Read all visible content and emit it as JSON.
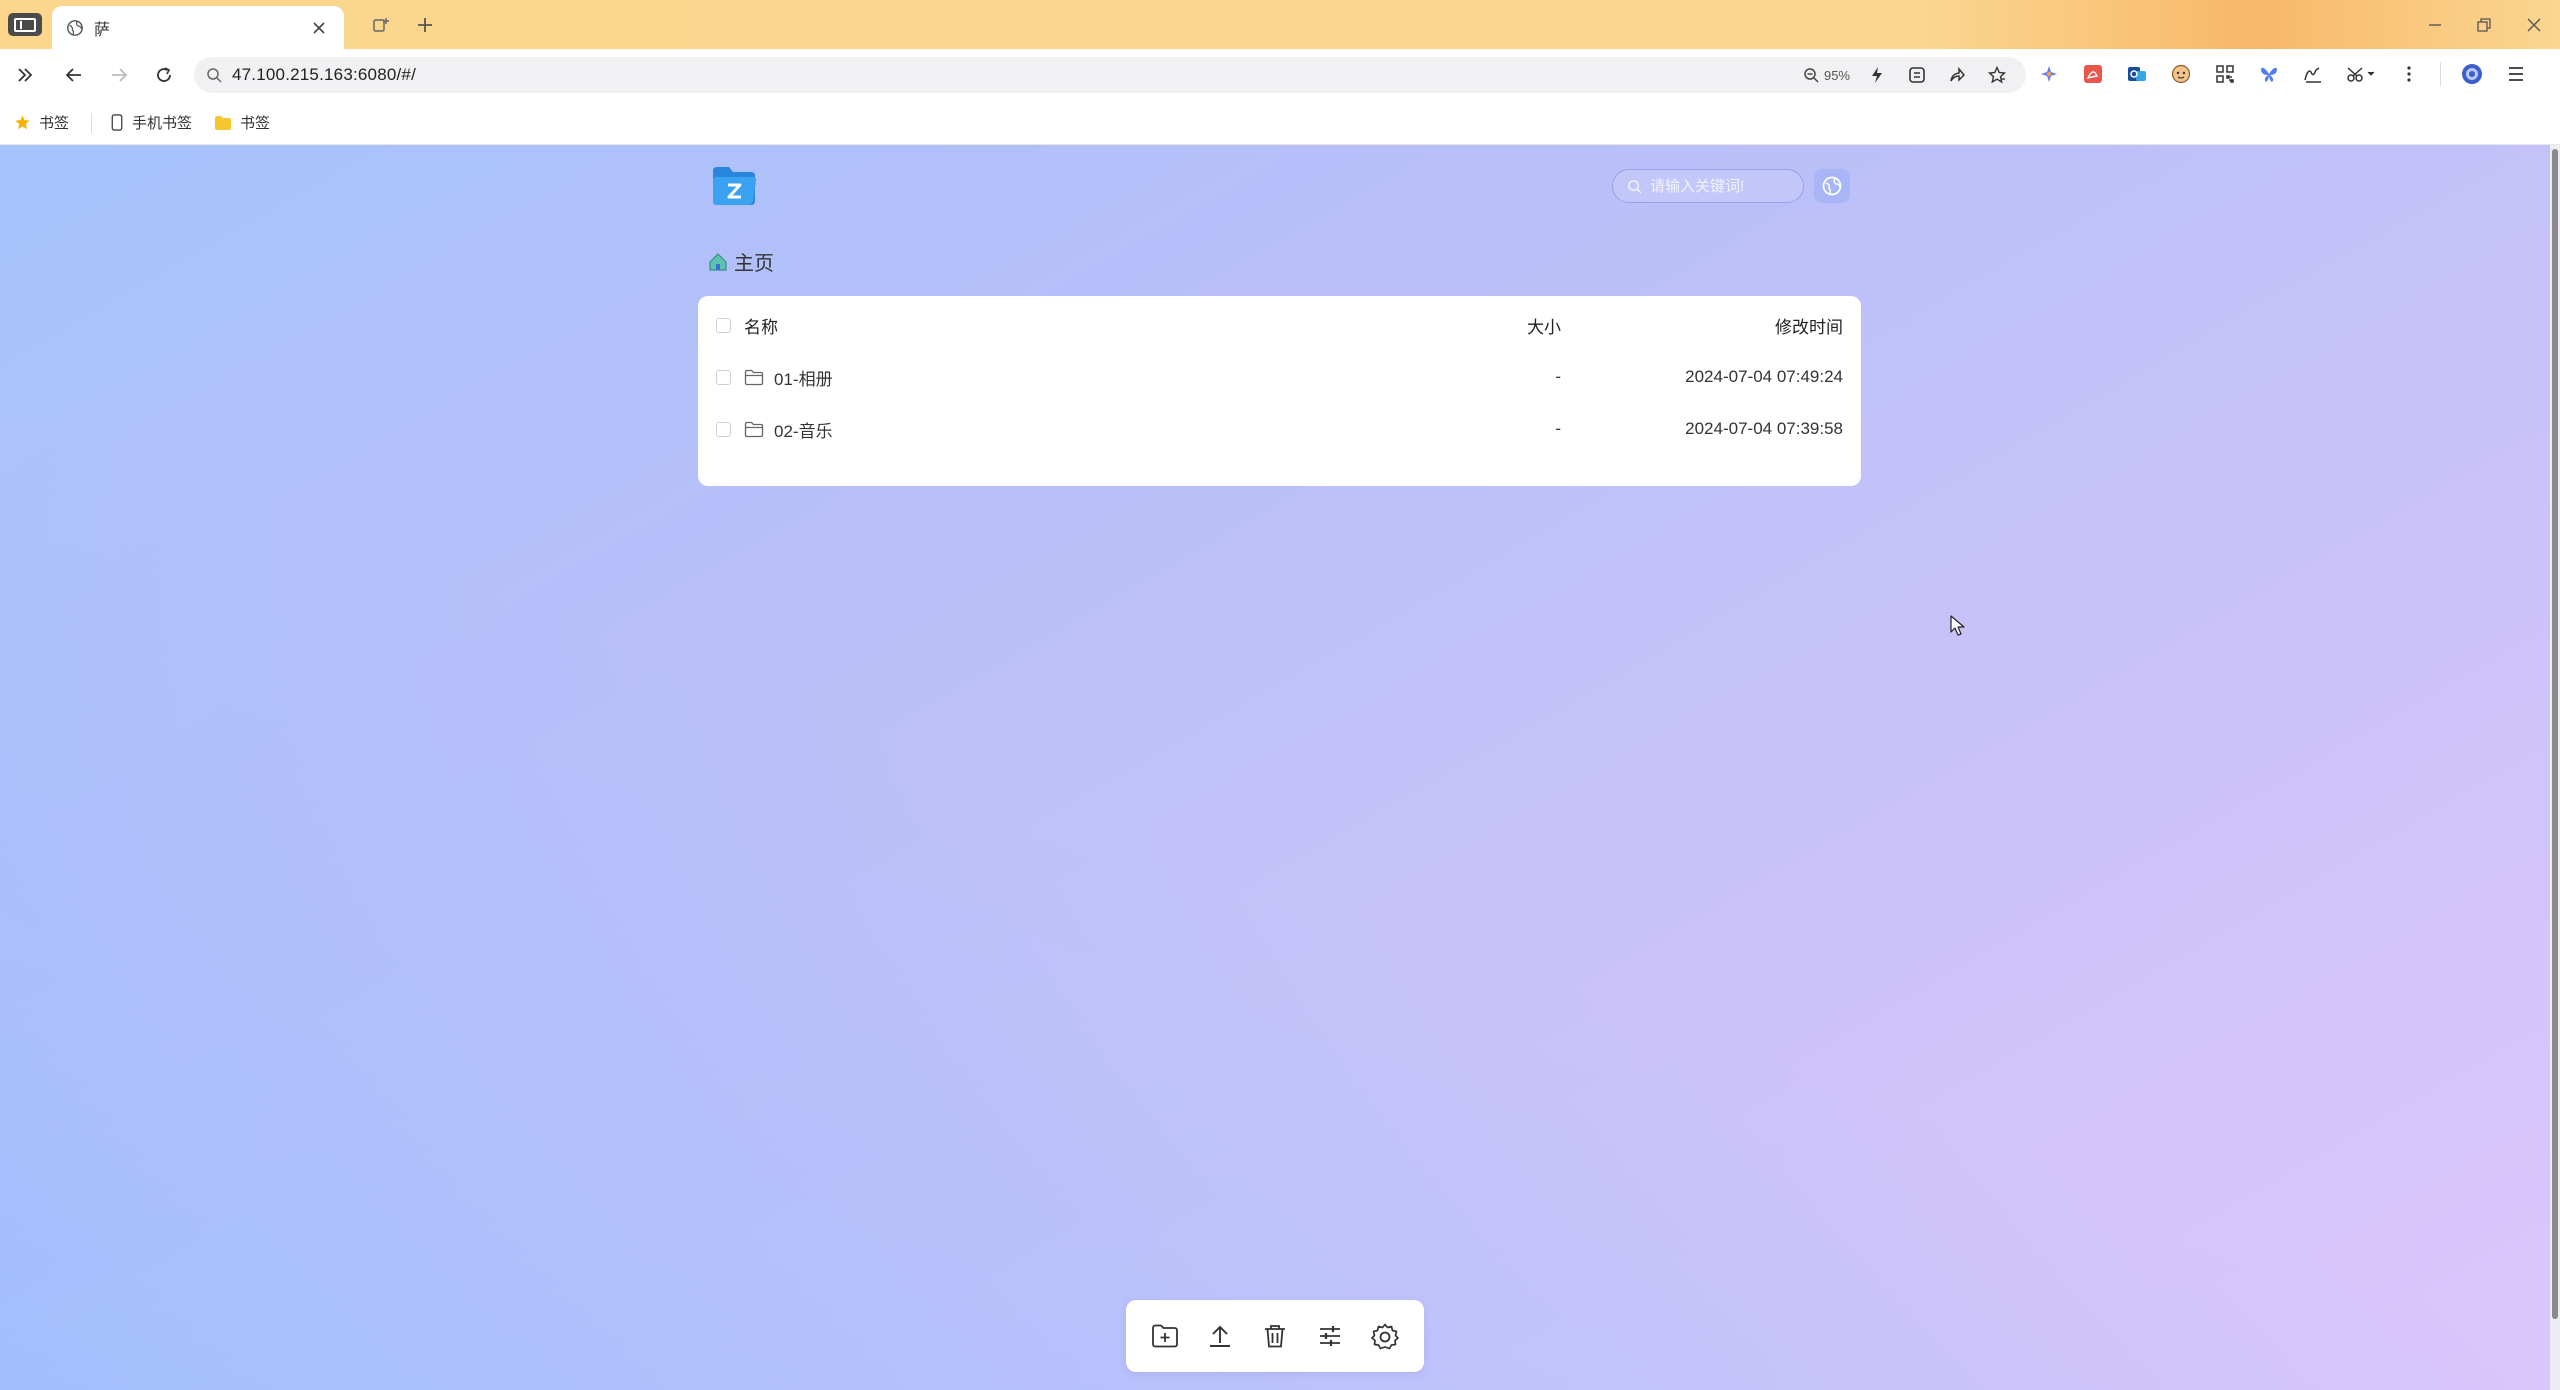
{
  "browser": {
    "tab_title": "萨",
    "url": "47.100.215.163:6080/#/",
    "zoom": "95%",
    "bookmarks": [
      {
        "label": "书签",
        "icon": "star-icon"
      },
      {
        "label": "手机书签",
        "icon": "phone-icon"
      },
      {
        "label": "书签",
        "icon": "folder-icon"
      }
    ]
  },
  "app": {
    "search_placeholder": "请输入关键词!",
    "breadcrumb": "主页",
    "table": {
      "columns": {
        "name": "名称",
        "size": "大小",
        "mtime": "修改时间"
      },
      "rows": [
        {
          "name": "01-相册",
          "size": "-",
          "mtime": "2024-07-04 07:49:24"
        },
        {
          "name": "02-音乐",
          "size": "-",
          "mtime": "2024-07-04 07:39:58"
        }
      ]
    },
    "dock_icons": [
      "new-folder-icon",
      "upload-icon",
      "delete-icon",
      "sliders-icon",
      "settings-icon"
    ]
  },
  "colors": {
    "accent": "#2b8fe5",
    "tabbar": "#fbd68c",
    "page_gradient_start": "#a6c3fb",
    "page_gradient_end": "#dcc6fb"
  }
}
